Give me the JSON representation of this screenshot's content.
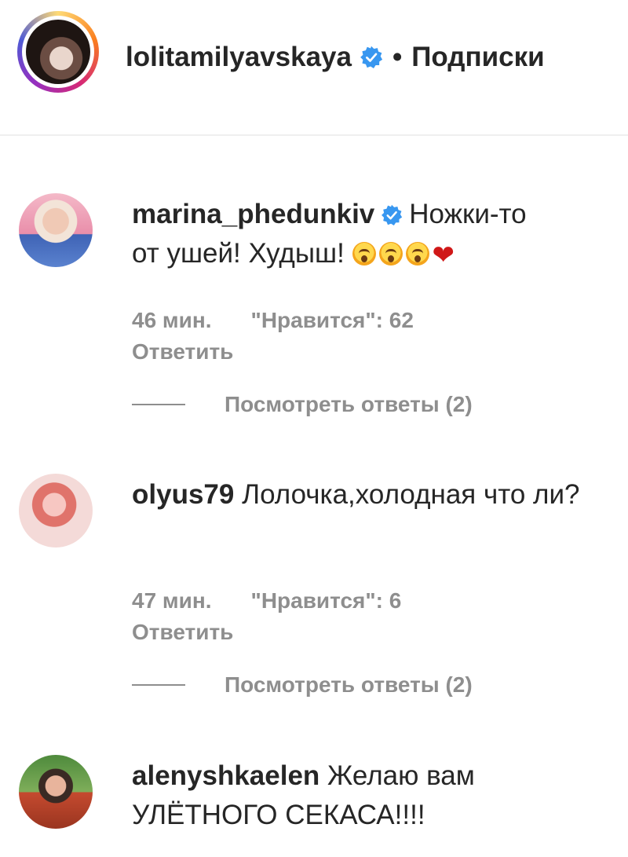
{
  "header": {
    "username": "lolitamilyavskaya",
    "separator": "•",
    "follow_status": "Подписки"
  },
  "comments": [
    {
      "username": "marina_phedunkiv",
      "verified": true,
      "text_line1": "Ножки-то",
      "text_line2": "от ушей! Худыш!",
      "emojis": [
        "astonished-face-icon",
        "astonished-face-icon",
        "astonished-face-icon",
        "red-heart-icon"
      ],
      "time": "46 мин.",
      "likes": "\"Нравится\": 62",
      "reply": "Ответить",
      "view_replies": "Посмотреть ответы (2)"
    },
    {
      "username": "olyus79",
      "verified": false,
      "text": "Лолочка,холодная что ли?",
      "time": "47 мин.",
      "likes": "\"Нравится\": 6",
      "reply": "Ответить",
      "view_replies": "Посмотреть ответы (2)"
    },
    {
      "username": "alenyshkaelen",
      "verified": false,
      "text": "Желаю вам УЛЁТНОГО СЕКАСА!!!!"
    }
  ],
  "colors": {
    "text": "#262626",
    "muted": "#8e8e8e",
    "verified_blue": "#3897f0",
    "heart_red": "#d01818"
  }
}
